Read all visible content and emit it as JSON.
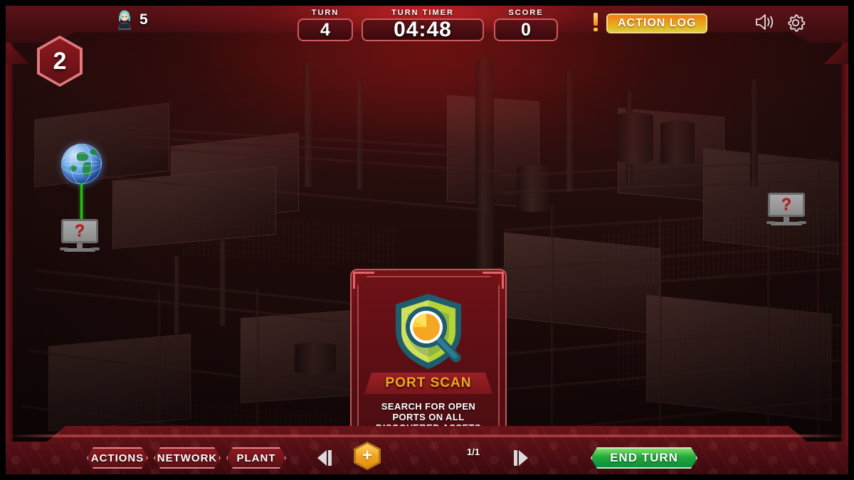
{
  "hud": {
    "level_badge": "2",
    "player_count": "5",
    "avatar_icon": "hacker-avatar-icon",
    "stats": [
      {
        "key": "turn",
        "label": "TURN",
        "value": "4"
      },
      {
        "key": "timer",
        "label": "TURN TIMER",
        "value": "04:48"
      },
      {
        "key": "score",
        "label": "SCORE",
        "value": "0"
      }
    ],
    "alert_icon": "alert-exclamation-icon",
    "action_log_label": "ACTION LOG",
    "sound_icon": "speaker-on-icon",
    "gear_icon": "gear-icon"
  },
  "map": {
    "nodes": [
      {
        "name": "internet-node",
        "icon": "globe-icon",
        "label": ""
      },
      {
        "name": "unknown-asset-left",
        "icon": "unknown-computer-icon",
        "label": "?"
      },
      {
        "name": "unknown-asset-right",
        "icon": "unknown-computer-icon",
        "label": "?"
      }
    ]
  },
  "card": {
    "title": "PORT SCAN",
    "description": "SEARCH FOR OPEN PORTS ON ALL DISCOVERED ASSETS",
    "art_icon": "shield-magnifier-icon",
    "counter": "1/1",
    "prev_icon": "prev-arrow-icon",
    "next_icon": "next-arrow-icon",
    "add_icon": "plus-hex-icon"
  },
  "bottom_bar": {
    "tabs": [
      {
        "key": "actions",
        "label": "ACTIONS"
      },
      {
        "key": "network",
        "label": "NETWORK"
      },
      {
        "key": "plant",
        "label": "PLANT"
      }
    ],
    "end_turn_label": "END TURN"
  },
  "colors": {
    "hud_red": "#4e0e13",
    "accent_orange": "#f0a81c",
    "end_turn_green": "#21a83a",
    "link_green": "#22c417",
    "card_title": "#f0a81c"
  }
}
